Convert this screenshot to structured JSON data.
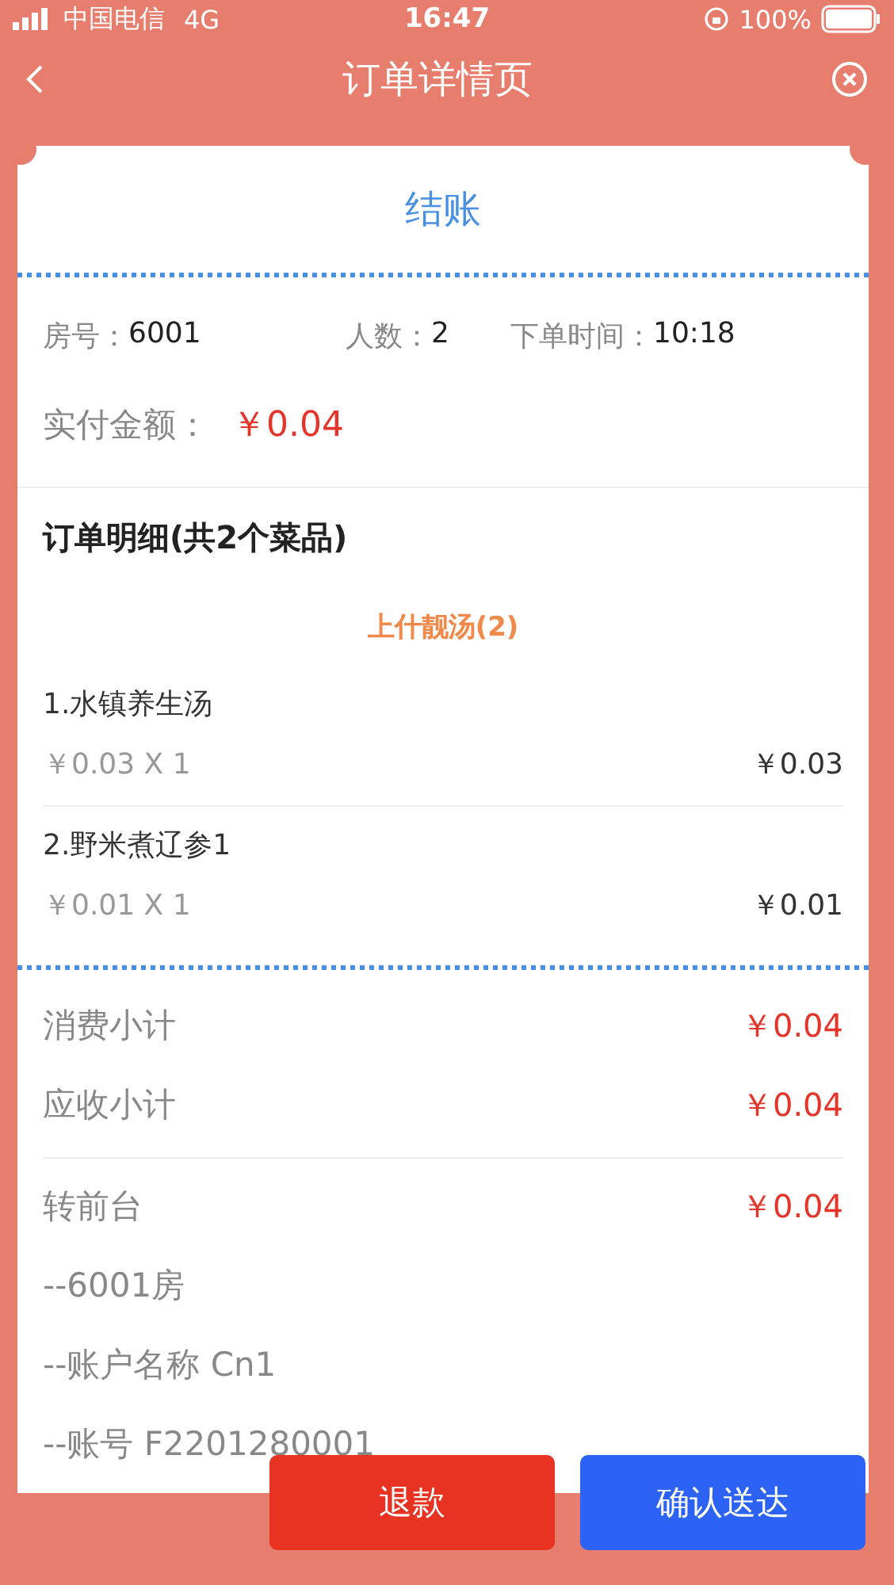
{
  "status_bar": {
    "carrier": "中国电信",
    "network": "4G",
    "time": "16:47",
    "battery": "100%"
  },
  "nav": {
    "title": "订单详情页"
  },
  "card": {
    "title": "结账",
    "info": [
      {
        "label": "房号：",
        "value": "6001"
      },
      {
        "label": "人数：",
        "value": "2"
      },
      {
        "label": "下单时间：",
        "value": "10:18"
      }
    ],
    "paid": {
      "label": "实付金额：",
      "value": "￥0.04"
    },
    "details_heading": "订单明细(共2个菜品)",
    "category": "上什靓汤(2)",
    "items": [
      {
        "name": "1.水镇养生汤",
        "unit": "￥0.03 X 1",
        "total": "￥0.03"
      },
      {
        "name": "2.野米煮辽参1",
        "unit": "￥0.01 X 1",
        "total": "￥0.01"
      }
    ],
    "totals": [
      {
        "label": "消费小计",
        "value": "￥0.04"
      },
      {
        "label": "应收小计",
        "value": "￥0.04"
      }
    ],
    "transfer": {
      "label": "转前台",
      "value": "￥0.04",
      "lines": [
        "--6001房",
        "--账户名称 Cn1",
        "--账号 F2201280001"
      ]
    }
  },
  "buttons": [
    {
      "label": "退款",
      "kind": "refund"
    },
    {
      "label": "确认送达",
      "kind": "confirm"
    }
  ]
}
